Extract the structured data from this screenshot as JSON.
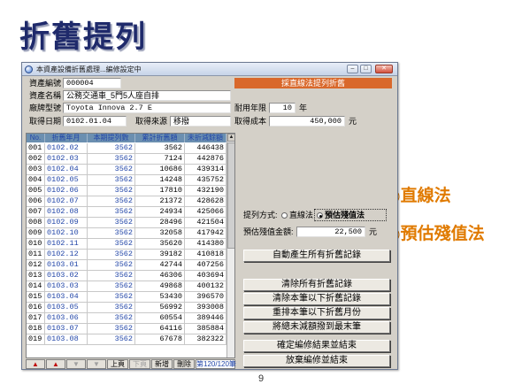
{
  "slide": {
    "title": "折舊提列",
    "callouts": [
      "◎直線法",
      "◎預估殘值法"
    ],
    "page_number": "9"
  },
  "window": {
    "title": "本資產設備折舊處理...編修設定中",
    "controls": {
      "minimize": "–",
      "maximize": "□",
      "close": "✕"
    }
  },
  "form": {
    "asset_id_label": "資產編號",
    "asset_id": "000004",
    "asset_name_label": "資產名稱",
    "asset_name": "公務交通車_5門5人座自排",
    "model_label": "廠牌型號",
    "model": "Toyota Innova 2.7 E",
    "acquire_date_label": "取得日期",
    "acquire_date": "0102.01.04",
    "source_label": "取得來源",
    "source": "移撥",
    "life_label": "耐用年限",
    "life": "10",
    "life_unit": "年",
    "cost_label": "取得成本",
    "cost": "450,000",
    "cost_unit": "元"
  },
  "method_header": "採直線法提列折舊",
  "table": {
    "columns": [
      "No.",
      "折舊年月",
      "本期提列數",
      "累計折舊額",
      "未折減餘額"
    ],
    "rows": [
      [
        "001",
        "0102.02",
        "3562",
        "3562",
        "446438"
      ],
      [
        "002",
        "0102.03",
        "3562",
        "7124",
        "442876"
      ],
      [
        "003",
        "0102.04",
        "3562",
        "10686",
        "439314"
      ],
      [
        "004",
        "0102.05",
        "3562",
        "14248",
        "435752"
      ],
      [
        "005",
        "0102.06",
        "3562",
        "17810",
        "432190"
      ],
      [
        "006",
        "0102.07",
        "3562",
        "21372",
        "428628"
      ],
      [
        "007",
        "0102.08",
        "3562",
        "24934",
        "425066"
      ],
      [
        "008",
        "0102.09",
        "3562",
        "28496",
        "421504"
      ],
      [
        "009",
        "0102.10",
        "3562",
        "32058",
        "417942"
      ],
      [
        "010",
        "0102.11",
        "3562",
        "35620",
        "414380"
      ],
      [
        "011",
        "0102.12",
        "3562",
        "39182",
        "410818"
      ],
      [
        "012",
        "0103.01",
        "3562",
        "42744",
        "407256"
      ],
      [
        "013",
        "0103.02",
        "3562",
        "46306",
        "403694"
      ],
      [
        "014",
        "0103.03",
        "3562",
        "49868",
        "400132"
      ],
      [
        "015",
        "0103.04",
        "3562",
        "53430",
        "396570"
      ],
      [
        "016",
        "0103.05",
        "3562",
        "56992",
        "393008"
      ],
      [
        "017",
        "0103.06",
        "3562",
        "60554",
        "389446"
      ],
      [
        "018",
        "0103.07",
        "3562",
        "64116",
        "385884"
      ],
      [
        "019",
        "0103.08",
        "3562",
        "67678",
        "382322"
      ]
    ]
  },
  "navbar": {
    "first": "▲",
    "prev": "▲",
    "next": "▼",
    "last": "▼",
    "page_up": "上頁",
    "page_down": "下頁",
    "add": "新增",
    "delete": "刪除",
    "status": "第120/120筆"
  },
  "options": {
    "method_label": "提列方式:",
    "straight_line": "直線法",
    "residual": "預估殘值法",
    "selected": "residual",
    "residual_label": "預估殘值金額:",
    "residual_value": "22,500",
    "residual_unit": "元"
  },
  "buttons": {
    "auto_generate": "自動產生所有折舊記錄",
    "clear_all": "清除所有折舊記錄",
    "clear_below": "清除本筆以下折舊記錄",
    "reorder": "重排本筆以下折舊月份",
    "move_remaining": "將總未減額撥到最末筆",
    "confirm": "確定編修結果並結束",
    "discard": "放棄編修並結束"
  }
}
